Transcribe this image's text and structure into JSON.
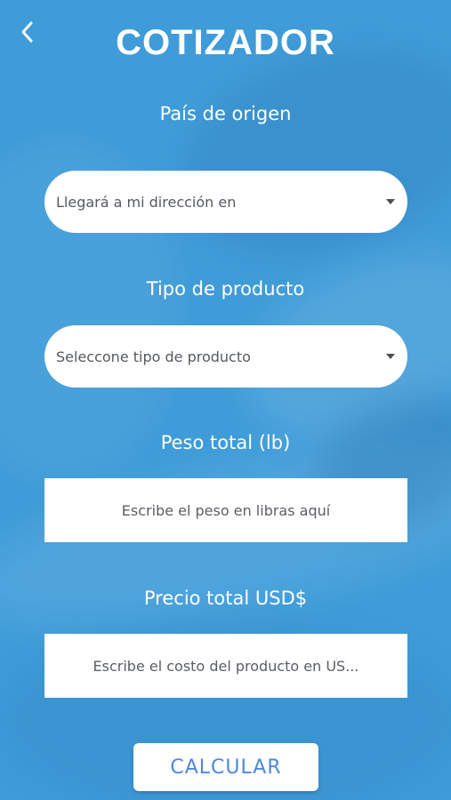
{
  "header": {
    "title": "COTIZADOR",
    "back_icon": "chevron-left-icon"
  },
  "form": {
    "origin": {
      "label": "País de origen",
      "selected_value": "Llegará a mi dirección en",
      "icon": "caret-down-icon"
    },
    "product_type": {
      "label": "Tipo de producto",
      "selected_value": "Seleccone tipo de producto",
      "icon": "caret-down-icon"
    },
    "weight": {
      "label": "Peso total (lb)",
      "placeholder": "Escribe el peso en libras aquí"
    },
    "price": {
      "label": "Precio total USD$",
      "placeholder": "Escribe el costo del producto en US..."
    }
  },
  "actions": {
    "calculate_label": "CALCULAR"
  },
  "colors": {
    "background": "#3f9cd8",
    "field_background": "#ffffff",
    "button_text": "#4c88dc",
    "heading_text": "#ffffff"
  }
}
